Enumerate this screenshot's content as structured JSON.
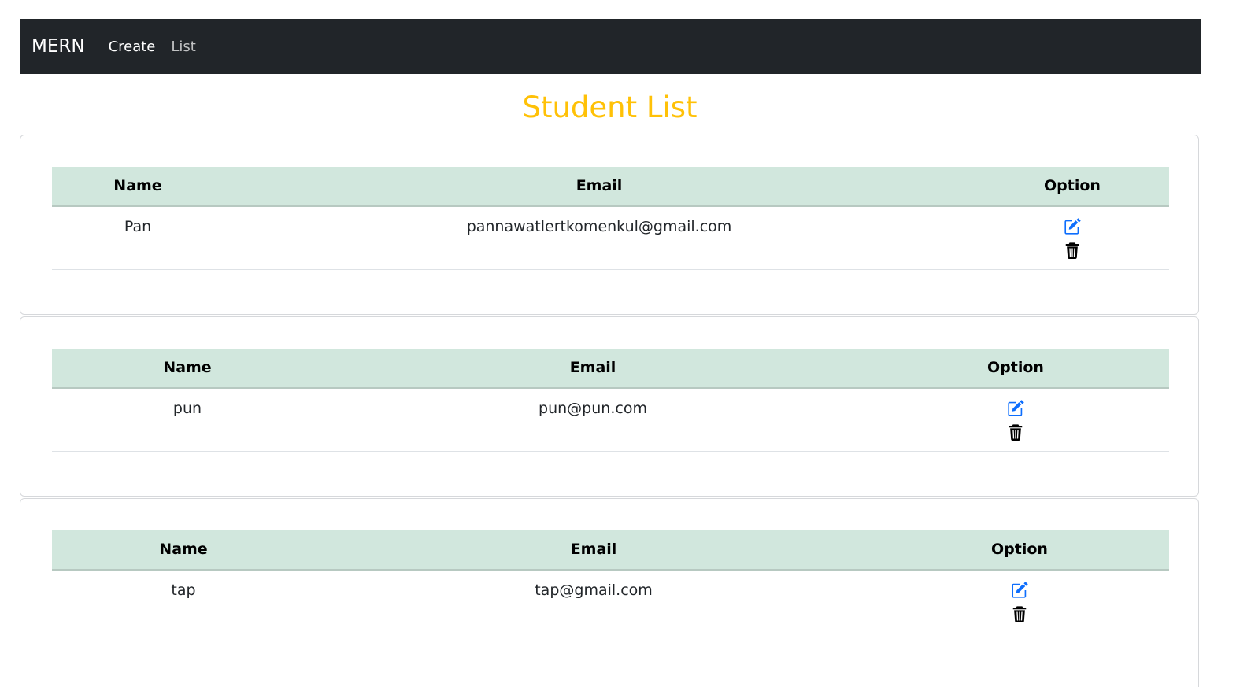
{
  "navbar": {
    "brand": "MERN",
    "links": [
      "Create",
      "List"
    ]
  },
  "page": {
    "title": "Student List"
  },
  "colors": {
    "navbar_bg": "#212529",
    "title": "#ffc107",
    "table_header_bg": "#d1e7dd",
    "edit_icon": "#0d6efd",
    "delete_icon": "#000000"
  },
  "icons": {
    "edit": "edit-icon",
    "delete": "trash-icon"
  },
  "tables": [
    {
      "headers": [
        "Name",
        "Email",
        "Option"
      ],
      "rows": [
        {
          "name": "Pan",
          "email": "pannawatlertkomenkul@gmail.com"
        }
      ]
    },
    {
      "headers": [
        "Name",
        "Email",
        "Option"
      ],
      "rows": [
        {
          "name": "pun",
          "email": "pun@pun.com"
        }
      ]
    },
    {
      "headers": [
        "Name",
        "Email",
        "Option"
      ],
      "rows": [
        {
          "name": "tap",
          "email": "tap@gmail.com"
        }
      ]
    }
  ]
}
